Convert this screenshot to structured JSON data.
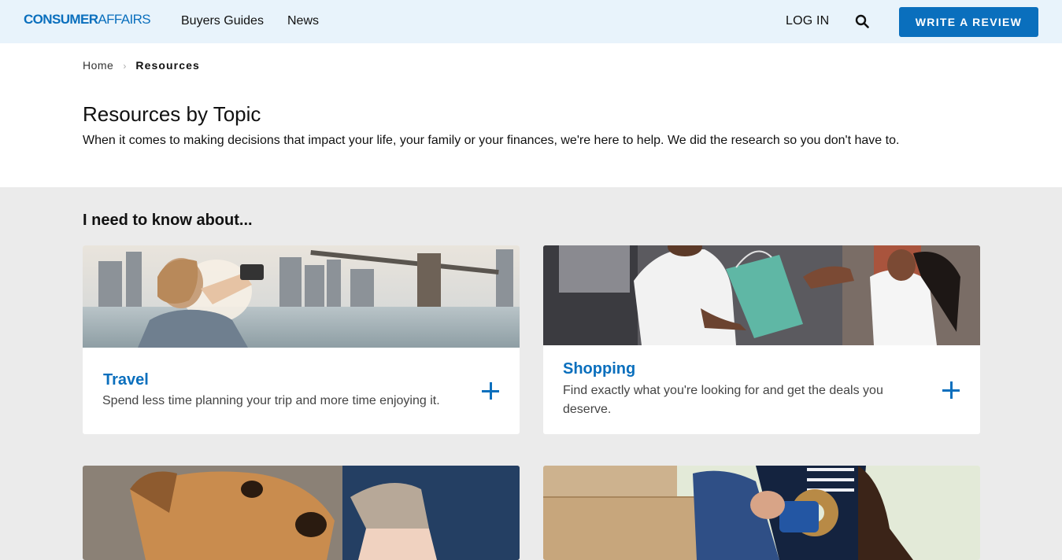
{
  "header": {
    "logo_bold": "CONSUMER",
    "logo_light": "AFFAIRS",
    "nav": [
      {
        "label": "Buyers Guides"
      },
      {
        "label": "News"
      }
    ],
    "login_label": "LOG IN",
    "search_icon": "search-icon",
    "review_button_label": "WRITE A REVIEW",
    "brand_color": "#0a6fbd",
    "header_bg": "#e8f3fb"
  },
  "breadcrumb": {
    "home": "Home",
    "separator": "›",
    "current": "Resources"
  },
  "intro": {
    "title": "Resources by Topic",
    "description": "When it comes to making decisions that impact your life, your family or your finances, we're here to help. We did the research so you don't have to."
  },
  "topics": {
    "heading": "I need to know about...",
    "cards": [
      {
        "title": "Travel",
        "description": "Spend less time planning your trip and more time enjoying it.",
        "icon": "plus-icon"
      },
      {
        "title": "Shopping",
        "description": "Find exactly what you're looking for and get the deals you deserve.",
        "icon": "plus-icon"
      }
    ]
  }
}
